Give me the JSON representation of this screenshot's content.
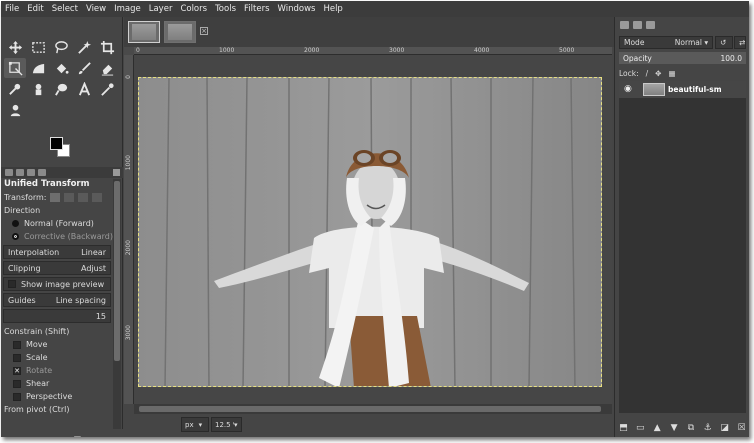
{
  "menubar": [
    "File",
    "Edit",
    "Select",
    "View",
    "Image",
    "Layer",
    "Colors",
    "Tools",
    "Filters",
    "Windows",
    "Help"
  ],
  "toolbox": {
    "tools": [
      "move-icon",
      "rect-select-icon",
      "lasso-icon",
      "fuzzy-select-icon",
      "crop-icon",
      "unified-transform-icon",
      "bucket-fill-icon",
      "blend-icon",
      "paintbrush-icon",
      "eraser-icon",
      "airbrush-icon",
      "clone-icon",
      "smudge-icon",
      "text-icon",
      "color-picker-icon",
      "zoom-icon"
    ]
  },
  "tool_options": {
    "title": "Unified Transform",
    "transform_label": "Transform:",
    "direction_label": "Direction",
    "direction_normal": "Normal (Forward)",
    "direction_corrective": "Corrective (Backward)",
    "interpolation_label": "Interpolation",
    "interpolation_value": "Linear",
    "clipping_label": "Clipping",
    "clipping_value": "Adjust",
    "show_preview": "Show image preview",
    "guides_label": "Guides",
    "guides_value": "Line spacing",
    "guides_num": "15",
    "constrain_label": "Constrain (Shift)",
    "constrain_items": [
      "Move",
      "Scale",
      "Rotate",
      "Shear",
      "Perspective"
    ],
    "pivot_label": "From pivot  (Ctrl)"
  },
  "ruler": {
    "h_labels": [
      "0",
      "1000",
      "2000",
      "3000",
      "4000",
      "5000"
    ],
    "v_labels": [
      "0",
      "1000",
      "2000",
      "3000"
    ]
  },
  "status": {
    "unit": "px",
    "zoom": "12.5 %"
  },
  "layers_panel": {
    "mode_label": "Mode",
    "mode_value": "Normal",
    "opacity_label": "Opacity",
    "opacity_value": "100.0",
    "lock_label": "Lock:",
    "layer_name": "beautiful-sm"
  },
  "colors": {
    "accent_selection": "#e8e080",
    "foreground": "#000000",
    "background": "#ffffff"
  }
}
